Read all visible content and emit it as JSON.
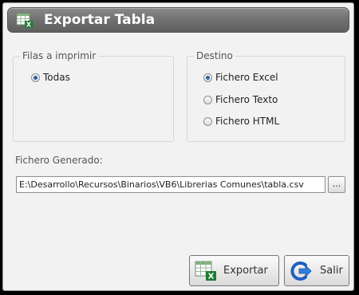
{
  "window": {
    "title": "Exportar Tabla"
  },
  "filas": {
    "legend": "Filas a imprimir",
    "options": [
      {
        "label": "Todas",
        "checked": true
      }
    ]
  },
  "destino": {
    "legend": "Destino",
    "options": [
      {
        "label": "Fichero Excel",
        "checked": true
      },
      {
        "label": "Fichero Texto",
        "checked": false
      },
      {
        "label": "Fichero HTML",
        "checked": false
      }
    ]
  },
  "output": {
    "label": "Fichero Generado:",
    "path": "E:\\Desarrollo\\Recursos\\Binarios\\VB6\\Librerias Comunes\\tabla.csv",
    "browse_label": "..."
  },
  "buttons": {
    "export_label": "Exportar",
    "exit_label": "Salir"
  },
  "icons": {
    "title": "excel-table-icon",
    "export": "excel-table-icon",
    "exit": "exit-arrow-icon"
  },
  "colors": {
    "titlebar": "#707070",
    "accent": "#2a5ea8",
    "excel_green": "#1e7b34"
  }
}
